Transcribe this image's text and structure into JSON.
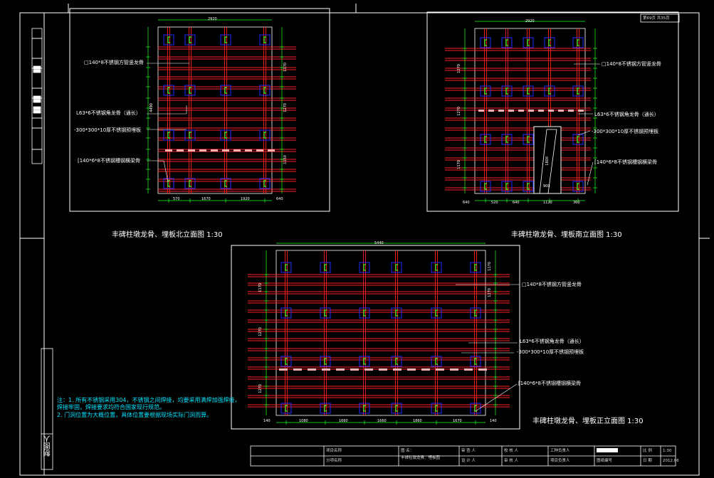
{
  "colors": {
    "background": "#000000",
    "frame": "#ffffff",
    "steel": "#ff2020",
    "plate": "#1e2cff",
    "clip": "#22ff22",
    "dim": "#22ff22",
    "text": "#ffffff",
    "note": "#00e5ff"
  },
  "page_number": "第69页  共35页",
  "side_stamp": "制图人",
  "views": {
    "north": {
      "title": "丰碑柱墩龙骨、埋板北立面图   1:30",
      "labels": {
        "vertical_keel": "□140*8不锈钢方管竖龙骨",
        "angle_keel": "L63*6不锈钢角龙骨（通长）",
        "embed_plate": "-300*300*10厚不锈钢预埋板",
        "channel_keel": "[140*6*8不锈钢槽钢横梁骨"
      },
      "dims": {
        "top": "2920",
        "bottom": [
          "570",
          "1670",
          "1920",
          "640"
        ],
        "left": "4490",
        "right": [
          "1170",
          "1270",
          "1150"
        ]
      }
    },
    "south": {
      "title": "丰碑柱墩龙骨、埋板南立面图   1:30",
      "labels": {
        "vertical_keel": "□140*8不锈钢方管竖龙骨",
        "angle_keel": "L63*6不锈钢角龙骨（通长）",
        "embed_plate": "-300*300*10厚不锈钢预埋板",
        "channel_keel": "[140*6*8不锈钢槽钢横梁骨"
      },
      "door_dims": [
        "1800",
        "900"
      ],
      "dims": {
        "top": "2920",
        "bottom": [
          "640",
          "520",
          "640",
          "1120",
          "360"
        ],
        "left": [
          "1270",
          "1270",
          "1170"
        ]
      }
    },
    "front": {
      "title": "丰碑柱墩龙骨、埋板正立面图   1:30",
      "labels": {
        "vertical_keel": "□140*8不锈钢方管竖龙骨",
        "angle_keel": "L63*6不锈钢角龙骨（通长）",
        "embed_plate": "-300*300*10厚不锈钢预埋板",
        "channel_keel": "[140*6*8不锈钢槽钢横梁骨"
      },
      "dims": {
        "top": "5440",
        "bottom": [
          "140",
          "1080",
          "1660",
          "1660",
          "1860",
          "1670",
          "140"
        ],
        "left": [
          "1170",
          "1270",
          "1270"
        ],
        "right": [
          "1170",
          "1270"
        ]
      }
    }
  },
  "notes": [
    "注：1. 所有不锈钢采用304，不锈钢之间焊接，均要采用满焊加强焊接，",
    "       焊接牢固，焊接要求均符合国家现行规范。",
    "    2. 门洞位置为大概位置，具体位置要根据现场实际门洞而算。"
  ],
  "title_block": {
    "project_name": "项目名称",
    "division_name": "分项名称",
    "drawing_label": "图  名：",
    "drawing_name": "丰碑柱墩龙骨、埋板图",
    "reviewer": "审 查 人",
    "designer": "设 计 人",
    "checker": "校 核 人",
    "approver": "审 核 人",
    "project_lead": "工种负责人",
    "section_lead": "项目负责人",
    "drawing_no": "图纸编号",
    "scale_label": "比  例",
    "scale_value": "1:30",
    "date_label": "日  期",
    "date_value": "2012.06"
  }
}
